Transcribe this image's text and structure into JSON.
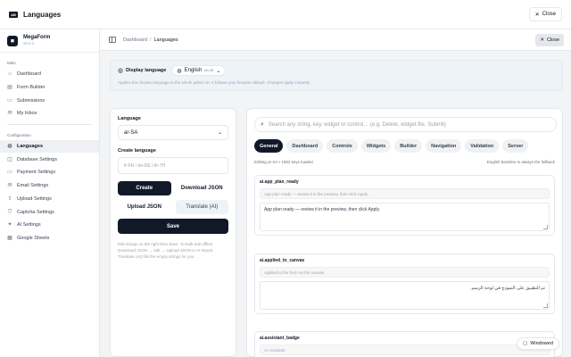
{
  "window": {
    "title": "Languages",
    "close_label": "Close"
  },
  "brand": {
    "name": "MegaForm",
    "version": "v5.0.1"
  },
  "sidebar": {
    "main_section": "Main",
    "main_items": [
      {
        "label": "Dashboard",
        "icon": "home-icon"
      },
      {
        "label": "Form Builder",
        "icon": "form-icon"
      },
      {
        "label": "Submissions",
        "icon": "inbox-icon"
      },
      {
        "label": "My Inbox",
        "icon": "mail-icon"
      }
    ],
    "config_section": "Configuration",
    "config_items": [
      {
        "label": "Languages",
        "icon": "globe-icon",
        "active": true
      },
      {
        "label": "Database Settings",
        "icon": "database-icon"
      },
      {
        "label": "Payment Settings",
        "icon": "card-icon"
      },
      {
        "label": "Email Settings",
        "icon": "mail-icon"
      },
      {
        "label": "Upload Settings",
        "icon": "upload-icon"
      },
      {
        "label": "Captcha Settings",
        "icon": "shield-icon"
      },
      {
        "label": "AI Settings",
        "icon": "sparkle-icon"
      },
      {
        "label": "Google Sheets",
        "icon": "sheet-icon"
      }
    ]
  },
  "header": {
    "breadcrumb_root": "Dashboard",
    "breadcrumb_current": "Languages",
    "close_label": "Close"
  },
  "display_language": {
    "label": "Display language",
    "selected": "English",
    "selected_code": "en-US",
    "description": "Applies the chosen language to the whole admin UI. It follows your browser default. Changes apply instantly."
  },
  "left": {
    "language_label": "Language",
    "language_value": "ar-SA",
    "create_label": "Create language",
    "create_placeholder": "fr-FR / de-DE / th-TH",
    "create_button": "Create",
    "download_button": "Download JSON",
    "upload_button": "Upload JSON",
    "translate_button": "Translate (AI)",
    "save_button": "Save",
    "note": "Edit strings on the right then Save. To bulk-edit offline: Download JSON → edit → Upload JSON to re-import. Translate (AI) fills the empty strings for you."
  },
  "right": {
    "search_placeholder": "Search any string, key, widget or control… (e.g. Delete, widget.file, Submit)",
    "tabs": [
      "General",
      "Dashboard",
      "Controls",
      "Widgets",
      "Builder",
      "Navigation",
      "Validation",
      "Server"
    ],
    "active_tab": "General",
    "editing_text": "Editing ar-SA • 1882 keys loaded",
    "baseline_text": "English baseline is always the fallback",
    "keys": [
      {
        "name": "ai.app_plan_ready",
        "reference": "App plan ready — review it in the preview, then click Apply.",
        "value": "App plan ready — review it in the preview, then click Apply.",
        "rtl": false
      },
      {
        "name": "ai.applied_to_canvas",
        "reference": "Applied to the form on the canvas.",
        "value": "تم التطبيق على النموذج في لوحة الرسم.",
        "rtl": true
      },
      {
        "name": "ai.assistant_badge",
        "reference": "AI Assistant",
        "value": "",
        "rtl": false
      }
    ]
  },
  "windowed_label": "Windowed"
}
